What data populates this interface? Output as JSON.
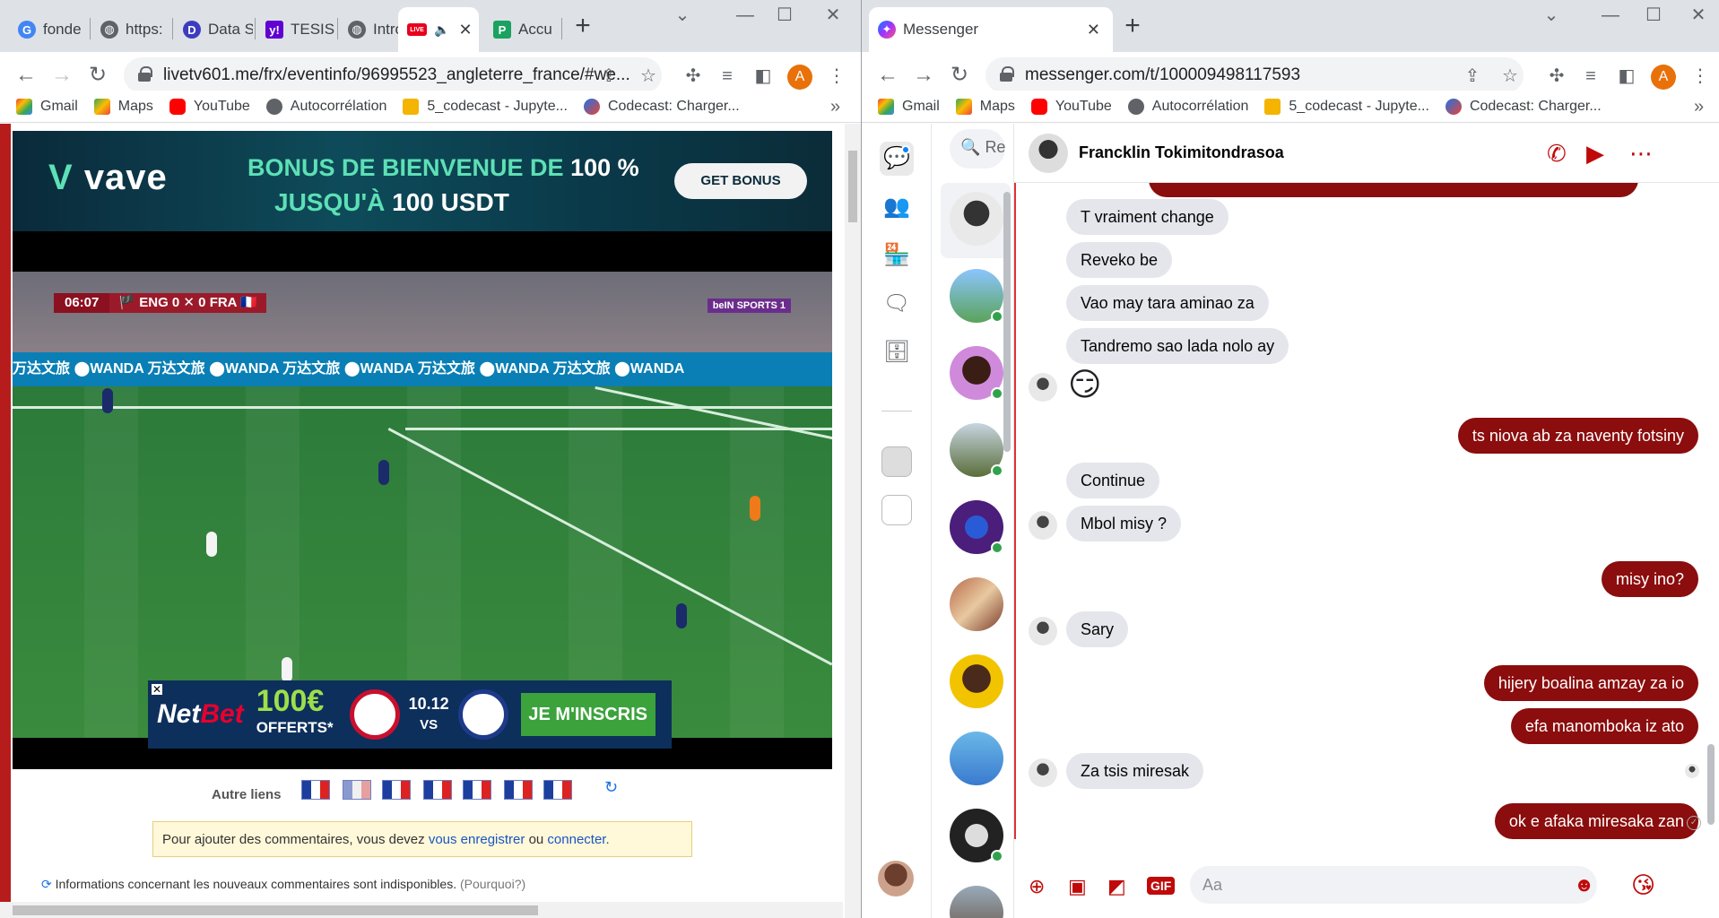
{
  "left": {
    "tabs": [
      {
        "label": "fonde",
        "icon": "google-icon",
        "color": "#4285f4"
      },
      {
        "label": "https:",
        "icon": "globe-icon",
        "color": "#5f6368"
      },
      {
        "label": "Data S",
        "icon": "d-icon",
        "color": "#3c3cc0"
      },
      {
        "label": "TESIS",
        "icon": "yahoo-icon",
        "color": "#6001d2"
      },
      {
        "label": "Introd",
        "icon": "globe-icon",
        "color": "#5f6368"
      },
      {
        "label": "",
        "icon": "live-icon",
        "color": "#e8001c",
        "active": true
      },
      {
        "label": "Accu",
        "icon": "p-icon",
        "color": "#1aa260"
      }
    ],
    "live_badge": "LIVE",
    "url": "livetv601.me/frx/eventinfo/96995523_angleterre_france/#we...",
    "bookmarks": [
      "Gmail",
      "Maps",
      "YouTube",
      "Autocorrélation",
      "5_codecast - Jupyte...",
      "Codecast: Charger..."
    ],
    "more": "»",
    "vave": {
      "logo": "vave",
      "line1_a": "BONUS DE BIENVENUE DE",
      "line1_b": "100 %",
      "line2_a": "JUSQU'À",
      "line2_b": "100 USDT",
      "button": "GET BONUS"
    },
    "score": {
      "clock": "06:07",
      "home": "ENG",
      "home_goals": "0",
      "away_goals": "0",
      "away": "FRA"
    },
    "broadcaster": "beIN SPORTS 1",
    "adboard": "万达文旅   ⬤WANDA   万达文旅   ⬤WANDA   万达文旅   ⬤WANDA   万达文旅   ⬤WANDA   万达文旅   ⬤WANDA",
    "netbet": {
      "logo_a": "Net",
      "logo_b": "Bet",
      "amount": "100€",
      "offered": "OFFERTS*",
      "date": "10.12",
      "vs": "VS",
      "button": "JE M'INSCRIS"
    },
    "autre_liens": "Autre liens",
    "comment": {
      "prefix": "Pour ajouter des commentaires, vous devez",
      "link1": "vous enregistrer",
      "mid": "ou",
      "link2": "connecter."
    },
    "infos": "Informations concernant les nouveaux commentaires sont indisponibles.",
    "infos_why": "(Pourquoi?)"
  },
  "right": {
    "tab": "Messenger",
    "url": "messenger.com/t/100009498117593",
    "bookmarks": [
      "Gmail",
      "Maps",
      "YouTube",
      "Autocorrélation",
      "5_codecast - Jupyte...",
      "Codecast: Charger..."
    ],
    "more": "»",
    "search_placeholder": "Re",
    "contact": "Francklin Tokimitondrasoa",
    "messages": [
      {
        "text": "T vraiment change",
        "dir": "in"
      },
      {
        "text": "Reveko be",
        "dir": "in"
      },
      {
        "text": "Vao may tara aminao za",
        "dir": "in"
      },
      {
        "text": "Tandremo sao lada nolo ay",
        "dir": "in"
      },
      {
        "text": "😏",
        "dir": "in"
      },
      {
        "text": "ts niova ab za naventy fotsiny",
        "dir": "out"
      },
      {
        "text": "Continue",
        "dir": "in"
      },
      {
        "text": "Mbol misy ?",
        "dir": "in"
      },
      {
        "text": "misy ino?",
        "dir": "out"
      },
      {
        "text": "Sary",
        "dir": "in"
      },
      {
        "text": "hijery boalina amzay za io",
        "dir": "out"
      },
      {
        "text": "efa manomboka iz ato",
        "dir": "out"
      },
      {
        "text": "Za tsis miresak",
        "dir": "in"
      },
      {
        "text": "ok e afaka miresaka zan",
        "dir": "out"
      }
    ],
    "composer_placeholder": "Aa"
  },
  "colors": {
    "accent_red": "#c00a0a",
    "out_bubble": "#8b0d0d",
    "in_bubble": "#e4e6eb",
    "online": "#31a24c"
  }
}
